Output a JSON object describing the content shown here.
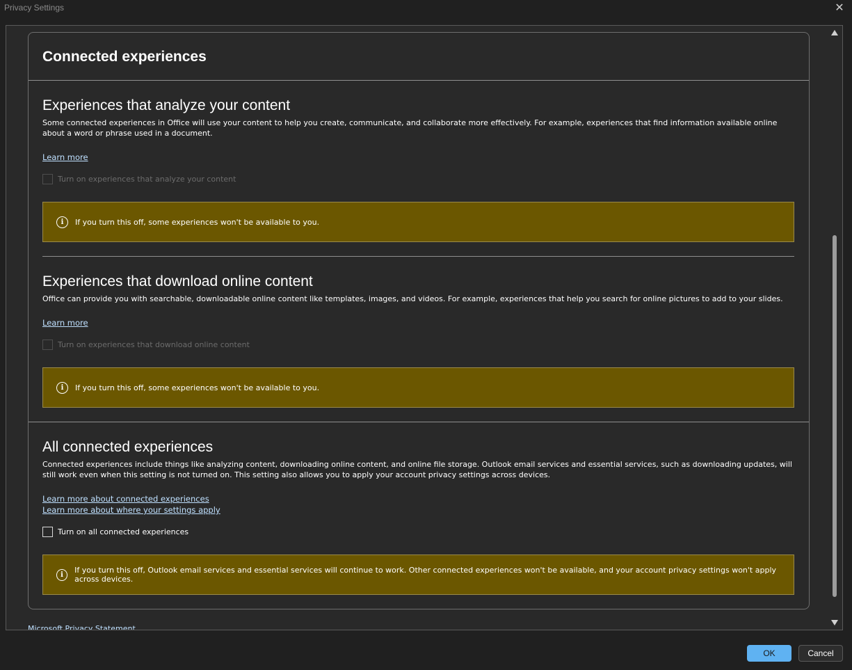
{
  "window": {
    "title": "Privacy Settings",
    "close_glyph": "✕"
  },
  "card": {
    "title": "Connected experiences"
  },
  "sections": [
    {
      "heading": "Experiences that analyze your content",
      "description": "Some connected experiences in Office will use your content to help you create, communicate, and collaborate more effectively. For example, experiences that find information available online about a word or phrase used in a document.",
      "links": [
        "Learn more"
      ],
      "checkbox_label": "Turn on experiences that analyze your content",
      "checkbox_checked": false,
      "checkbox_enabled": false,
      "warning": "If you turn this off, some experiences won't be available to you."
    },
    {
      "heading": "Experiences that download online content",
      "description": "Office can provide you with searchable, downloadable online content like templates, images, and videos. For example, experiences that help you search for online pictures to add to your slides.",
      "links": [
        "Learn more"
      ],
      "checkbox_label": "Turn on experiences that download online content",
      "checkbox_checked": false,
      "checkbox_enabled": false,
      "warning": "If you turn this off, some experiences won't be available to you."
    },
    {
      "heading": "All connected experiences",
      "description": "Connected experiences include things like analyzing content, downloading online content, and online file storage. Outlook email services and essential services, such as downloading updates, will still work even when this setting is not turned on. This setting also allows you to apply your account privacy settings across devices.",
      "links": [
        "Learn more about connected experiences",
        "Learn more about where your settings apply"
      ],
      "checkbox_label": "Turn on all connected experiences",
      "checkbox_checked": false,
      "checkbox_enabled": true,
      "warning": "If you turn this off, Outlook email services and essential services will continue to work. Other connected experiences won't be available, and your account privacy settings won't apply across devices."
    }
  ],
  "footer_link": "Microsoft Privacy Statement",
  "buttons": {
    "ok": "OK",
    "cancel": "Cancel"
  },
  "colors": {
    "warning_bg": "#6b5700",
    "link": "#bfe0ff",
    "ok_button": "#5fb2f2"
  },
  "icons": {
    "info": "i"
  }
}
